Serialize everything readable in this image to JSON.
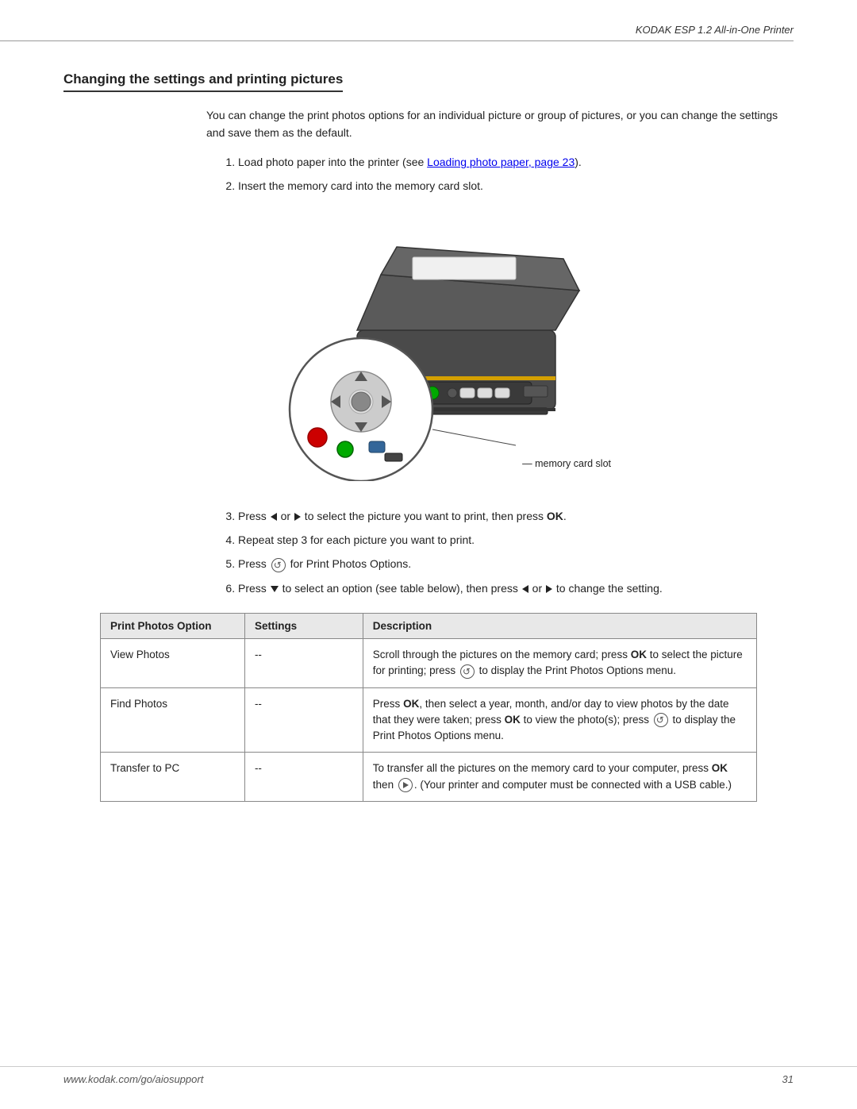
{
  "header": {
    "title": "KODAK ESP 1.2 All-in-One Printer"
  },
  "section": {
    "title": "Changing the settings and printing pictures"
  },
  "intro": {
    "text": "You can change the print photos options for an individual picture or group of pictures, or you can change the settings and save them as the default."
  },
  "steps_initial": [
    {
      "number": 1,
      "text": "Load photo paper into the printer (see ",
      "link_text": "Loading photo paper, page 23",
      "text_after": ")."
    },
    {
      "number": 2,
      "text": "Insert the memory card into the memory card slot."
    }
  ],
  "image_label": "memory card slot",
  "steps_continued": [
    {
      "number": 3,
      "text_before": "Press ",
      "arrow_left": true,
      "or": " or ",
      "arrow_right": true,
      "text_after": " to select the picture you want to print, then press ",
      "bold_text": "OK",
      "period": "."
    },
    {
      "number": 4,
      "text": "Repeat step 3 for each picture you want to print."
    },
    {
      "number": 5,
      "text_before": "Press ",
      "has_home": true,
      "text_after": " for Print Photos Options."
    },
    {
      "number": 6,
      "text_before": "Press ",
      "has_arrow_down": true,
      "text_middle": " to select an option (see table below), then press ",
      "arrow_left": true,
      "or2": " or ",
      "arrow_right": true,
      "text_after": " to change the setting."
    }
  ],
  "table": {
    "headers": [
      "Print Photos Option",
      "Settings",
      "Description"
    ],
    "rows": [
      {
        "option": "View Photos",
        "settings": "--",
        "description": "Scroll through the pictures on the memory card; press OK to select the picture for printing; press  to display the Print Photos Options menu."
      },
      {
        "option": "Find Photos",
        "settings": "--",
        "description": "Press OK, then select a year, month, and/or day to view photos by the date that they were taken; press OK to view the photo(s); press  to display the Print Photos Options menu."
      },
      {
        "option": "Transfer to PC",
        "settings": "--",
        "description": "To transfer all the pictures on the memory card to your computer, press OK then . (Your printer and computer must be connected with a USB cable.)"
      }
    ]
  },
  "footer": {
    "url": "www.kodak.com/go/aiosupport",
    "page_number": "31"
  }
}
